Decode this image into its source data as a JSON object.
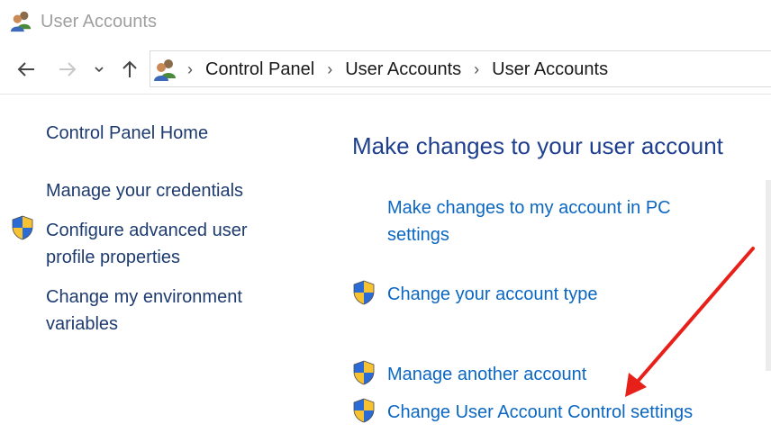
{
  "window": {
    "title": "User Accounts",
    "title_icon": "user-accounts-icon"
  },
  "navigation": {
    "back_icon": "arrow-left-icon",
    "forward_icon": "arrow-right-icon",
    "recent_icon": "chevron-down-icon",
    "up_icon": "arrow-up-icon",
    "breadcrumb": [
      "Control Panel",
      "User Accounts",
      "User Accounts"
    ]
  },
  "sidebar": {
    "items": [
      {
        "label": "Control Panel Home",
        "shield": false
      },
      {
        "label": "Manage your credentials",
        "shield": false
      },
      {
        "label": "Configure advanced user profile properties",
        "shield": true
      },
      {
        "label": "Change my environment variables",
        "shield": false
      }
    ]
  },
  "main": {
    "heading": "Make changes to your user account",
    "links": [
      {
        "label": "Make changes to my account in PC settings",
        "shield": false
      },
      {
        "label": "Change your account type",
        "shield": true
      },
      {
        "label": "Manage another account",
        "shield": true
      },
      {
        "label": "Change User Account Control settings",
        "shield": true
      }
    ]
  },
  "colors": {
    "link_left": "#1e3b70",
    "link_main": "#0b67c2",
    "heading": "#1e3f8e",
    "annotation_arrow": "#e8201a",
    "shield_blue": "#2b6bd6",
    "shield_yellow": "#f6c231"
  }
}
